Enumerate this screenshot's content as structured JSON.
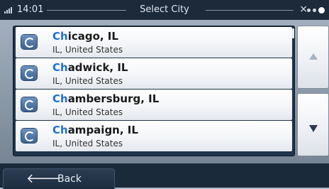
{
  "status_bar": {
    "time": "14:01",
    "title": "Select City",
    "signal_icon": "signal-bars-icon",
    "satellite_icon": "satellite-icon",
    "status_dots_icon": "status-dots-icon"
  },
  "cities": [
    {
      "highlight": "Ch",
      "rest": "icago, IL",
      "sub": "IL, United States",
      "icon": "city-pin-icon"
    },
    {
      "highlight": "Ch",
      "rest": "adwick, IL",
      "sub": "IL, United States",
      "icon": "city-pin-icon"
    },
    {
      "highlight": "Ch",
      "rest": "ambersburg, IL",
      "sub": "IL, United States",
      "icon": "city-pin-icon"
    },
    {
      "highlight": "Ch",
      "rest": "ampaign, IL",
      "sub": "IL, United States",
      "icon": "city-pin-icon"
    }
  ],
  "scroll": {
    "up_icon": "scroll-up-arrow-icon",
    "down_icon": "scroll-down-arrow-icon"
  },
  "back": {
    "label": "Back",
    "icon": "back-arrow-icon"
  },
  "colors": {
    "highlight": "#1f6fd4",
    "panel": "#20344a",
    "statusbar": "#1c2a3a"
  }
}
